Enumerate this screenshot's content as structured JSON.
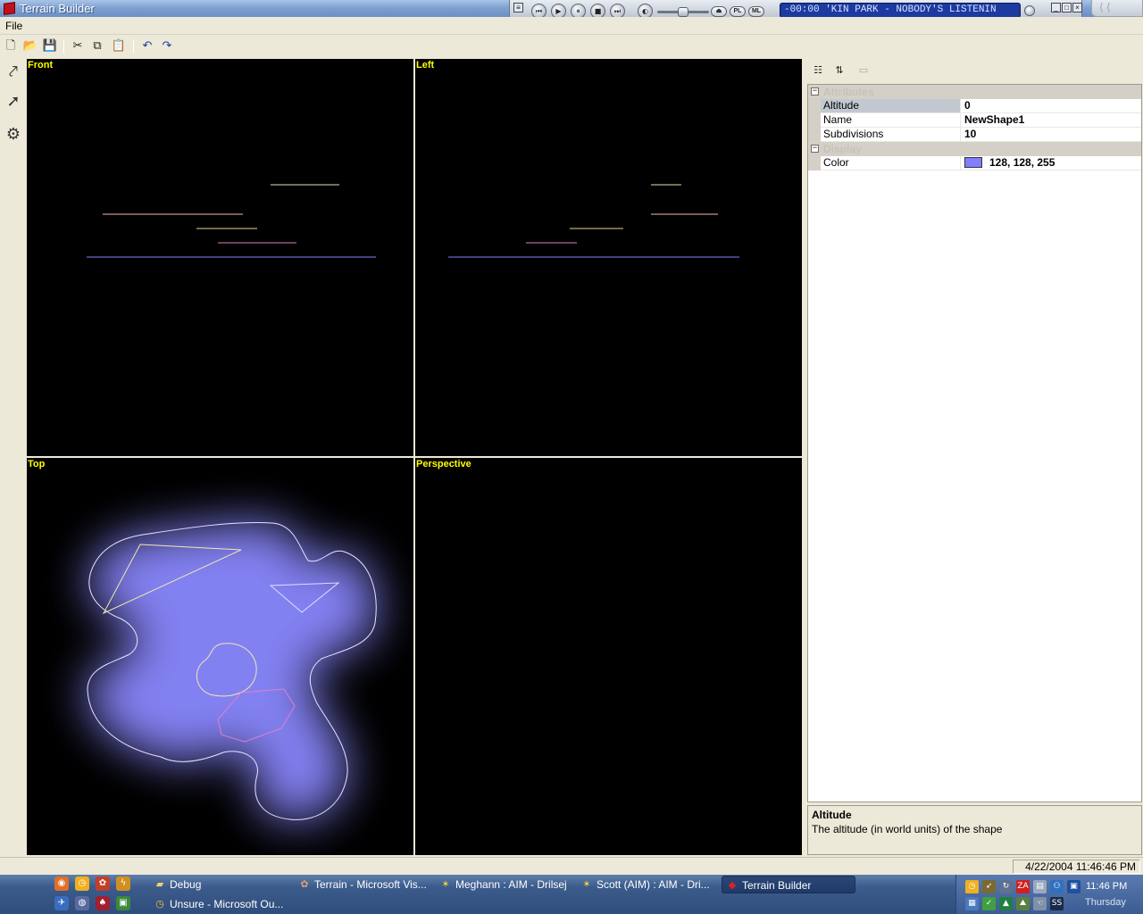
{
  "window": {
    "title": "Terrain Builder"
  },
  "player": {
    "display": "-00:00 'KIN PARK - NOBODY'S LISTENIN",
    "buttons": {
      "prev": "⏮",
      "play": "▶",
      "pause": "⏸",
      "stop": "■",
      "next": "⏭",
      "eject": "⏏",
      "pl": "PL",
      "ml": "ML"
    }
  },
  "menu": {
    "file": "File"
  },
  "viewports": {
    "front": "Front",
    "left": "Left",
    "top": "Top",
    "perspective": "Perspective"
  },
  "properties": {
    "categories": {
      "attributes": "Attributes",
      "display": "Display"
    },
    "rows": [
      {
        "name": "Altitude",
        "value": "0"
      },
      {
        "name": "Name",
        "value": "NewShape1"
      },
      {
        "name": "Subdivisions",
        "value": "10"
      }
    ],
    "display_rows": [
      {
        "name": "Color",
        "value": "128, 128, 255",
        "swatch": "#8080ff"
      }
    ],
    "help": {
      "title": "Altitude",
      "text": "The altitude (in world units) of the shape"
    }
  },
  "status": {
    "datetime": "4/22/2004 11:46:46 PM"
  },
  "taskbar": {
    "tasks": [
      {
        "label": "Debug"
      },
      {
        "label": "Terrain - Microsoft Vis..."
      },
      {
        "label": "Meghann : AIM - Drilsej"
      },
      {
        "label": "Scott (AIM) : AIM - Dri..."
      },
      {
        "label": "Terrain Builder"
      },
      {
        "label": "Unsure - Microsoft Ou..."
      }
    ],
    "clock": "11:46 PM",
    "day": "Thursday"
  },
  "colors": {
    "accent": "#8080ff",
    "label": "#ffff00"
  }
}
